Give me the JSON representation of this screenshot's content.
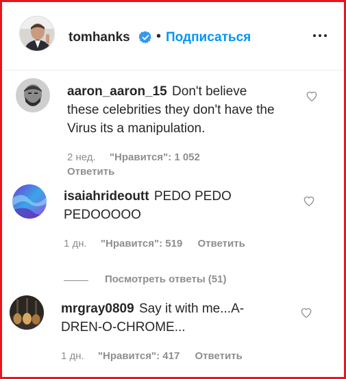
{
  "header": {
    "username": "tomhanks",
    "separator": "•",
    "follow_label": "Подписаться",
    "verified_color": "#3897f0",
    "accent": "#0095f6"
  },
  "comments": [
    {
      "username": "aaron_aaron_15",
      "text": "Don't believe these celebrities they don't have the Virus its a manipulation.",
      "time": "2 нед.",
      "likes": "\"Нравится\": 1 052",
      "reply_label": "Ответить"
    },
    {
      "username": "isaiahrideoutt",
      "text": "PEDO PEDO PEDOOOOO",
      "time": "1 дн.",
      "likes": "\"Нравится\": 519",
      "reply_label": "Ответить"
    },
    {
      "username": "mrgray0809",
      "text": "Say it with me...A-DREN-O-CHROME...",
      "time": "1 дн.",
      "likes": "\"Нравится\": 417",
      "reply_label": "Ответить"
    }
  ],
  "view_replies_label": "Посмотреть ответы (51)",
  "icons": {
    "more": "more-options-icon",
    "heart": "heart-outline-icon",
    "verified": "verified-badge-icon"
  },
  "frame_color": "#e8141c"
}
